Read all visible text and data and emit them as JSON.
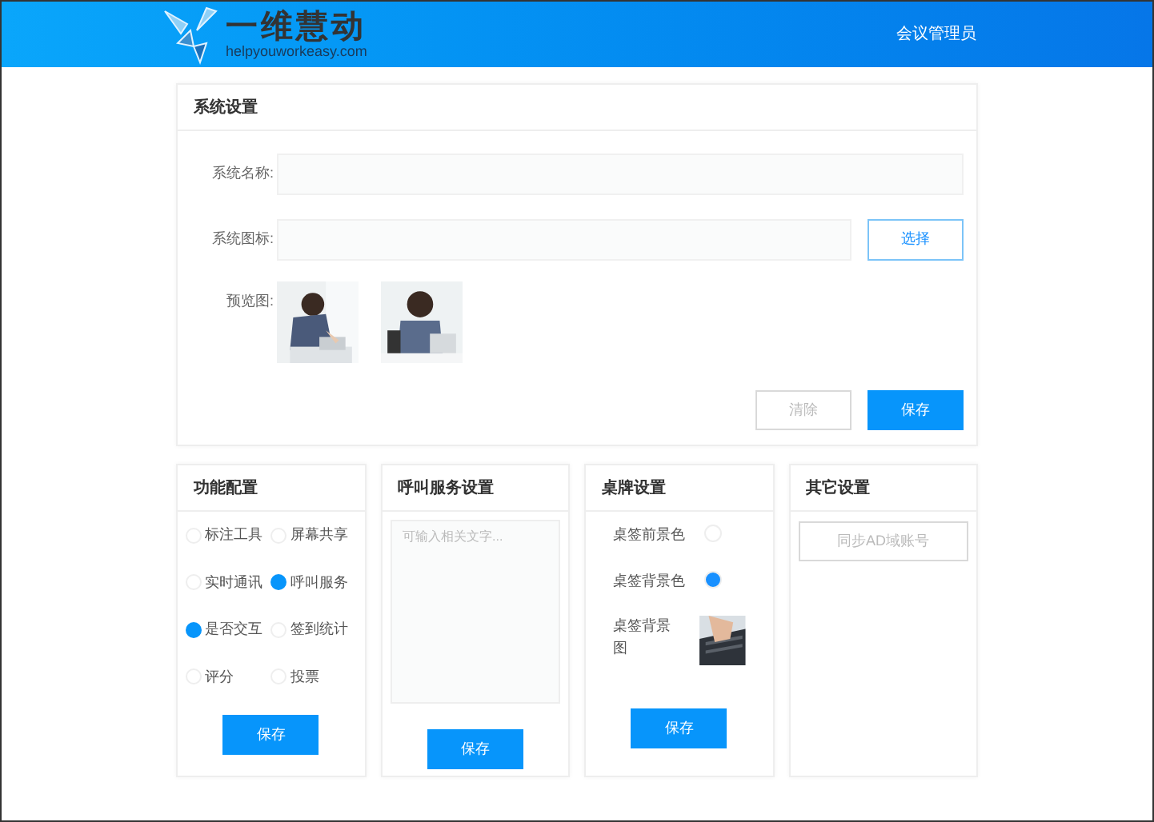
{
  "header": {
    "logo_text": "一维慧动",
    "logo_sub": "helpyouworkeasy.com",
    "user": "会议管理员"
  },
  "system": {
    "title": "系统设置",
    "name_label": "系统名称:",
    "icon_label": "系统图标:",
    "choose_button": "选择",
    "preview_label": "预览图:",
    "clear_button": "清除",
    "save_button": "保存"
  },
  "features": {
    "title": "功能配置",
    "items": [
      {
        "label": "标注工具",
        "checked": false
      },
      {
        "label": "屏幕共享",
        "checked": false
      },
      {
        "label": "实时通讯",
        "checked": false
      },
      {
        "label": "呼叫服务",
        "checked": true
      },
      {
        "label": "是否交互",
        "checked": true
      },
      {
        "label": "签到统计",
        "checked": false
      },
      {
        "label": "评分",
        "checked": false
      },
      {
        "label": "投票",
        "checked": false
      }
    ],
    "save_button": "保存"
  },
  "call_service": {
    "title": "呼叫服务设置",
    "placeholder": "可输入相关文字...",
    "save_button": "保存"
  },
  "desk_sign": {
    "title": "桌牌设置",
    "rows": [
      {
        "kind": "color",
        "label": "桌签前景色",
        "color": "#ffffff"
      },
      {
        "kind": "color",
        "label": "桌签背景色",
        "color": "#1890ff"
      },
      {
        "label": "桌签背景图"
      }
    ],
    "save_button": "保存"
  },
  "other": {
    "title": "其它设置",
    "sync_button": "同步AD域账号"
  }
}
